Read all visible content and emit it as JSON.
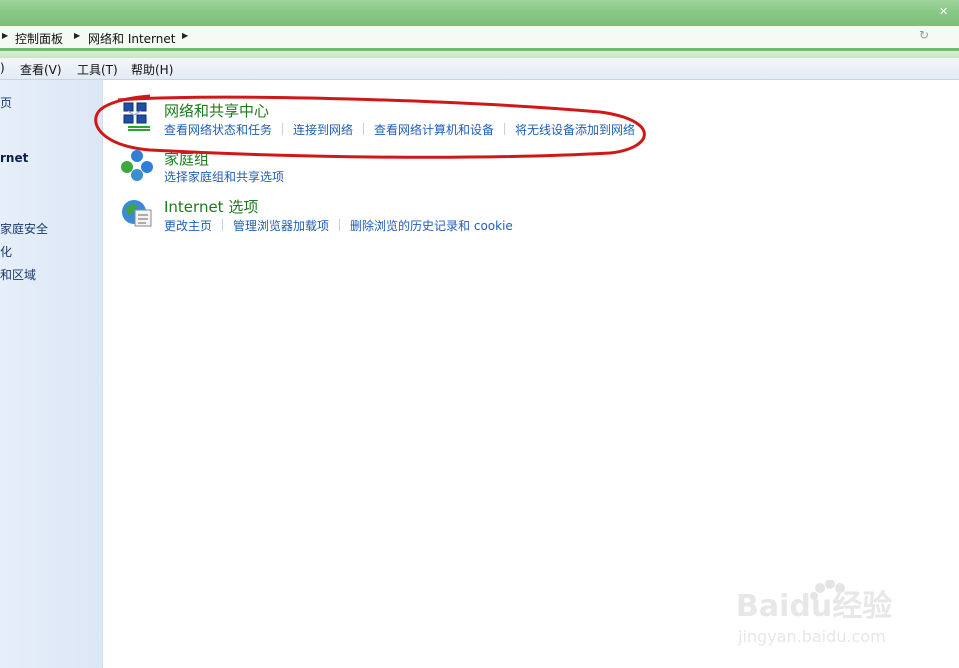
{
  "breadcrumb": [
    "控制面板",
    "网络和 Internet"
  ],
  "menu": [
    "查看(V)",
    "工具(T)",
    "帮助(H)"
  ],
  "left_panel": [
    "页",
    "rnet",
    "家庭安全",
    "化",
    "和区域"
  ],
  "sections": [
    {
      "title": "网络和共享中心",
      "icon": "network-center-icon",
      "links": [
        "查看网络状态和任务",
        "连接到网络",
        "查看网络计算机和设备",
        "将无线设备添加到网络"
      ]
    },
    {
      "title": "家庭组",
      "icon": "homegroup-icon",
      "links": [
        "选择家庭组和共享选项"
      ]
    },
    {
      "title": "Internet 选项",
      "icon": "internet-options-icon",
      "links": [
        "更改主页",
        "管理浏览器加载项",
        "删除浏览的历史记录和 cookie"
      ]
    }
  ],
  "watermark": {
    "brand": "Baidu经验",
    "url": "jingyan.baidu.com"
  },
  "colors": {
    "title_green": "#1e7a1e",
    "link_blue": "#1f5fb5",
    "annotation_red": "#d01818"
  }
}
